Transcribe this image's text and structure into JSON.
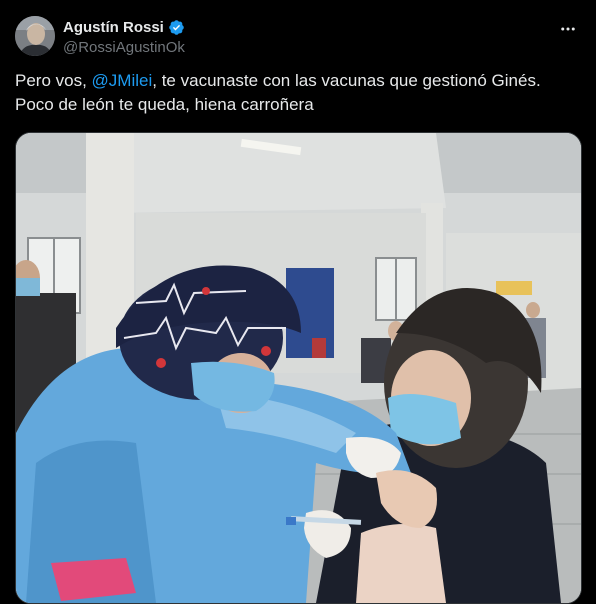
{
  "author": {
    "display_name": "Agustín Rossi",
    "handle": "@RossiAgustinOk",
    "verified": true,
    "avatar_icon": "profile-photo"
  },
  "more_icon": "more-horizontal-icon",
  "tweet": {
    "line1_before": "Pero vos, ",
    "mention": "@JMilei",
    "line1_after": ", te vacunaste con las vacunas que gestionó Ginés.",
    "line2": "Poco de león te queda, hiena carroñera"
  },
  "media": {
    "kind": "photo"
  },
  "colors": {
    "background": "#000000",
    "text": "#e7e9ea",
    "secondary": "#71767b",
    "accent": "#1d9bf0",
    "border": "#2f3336"
  }
}
